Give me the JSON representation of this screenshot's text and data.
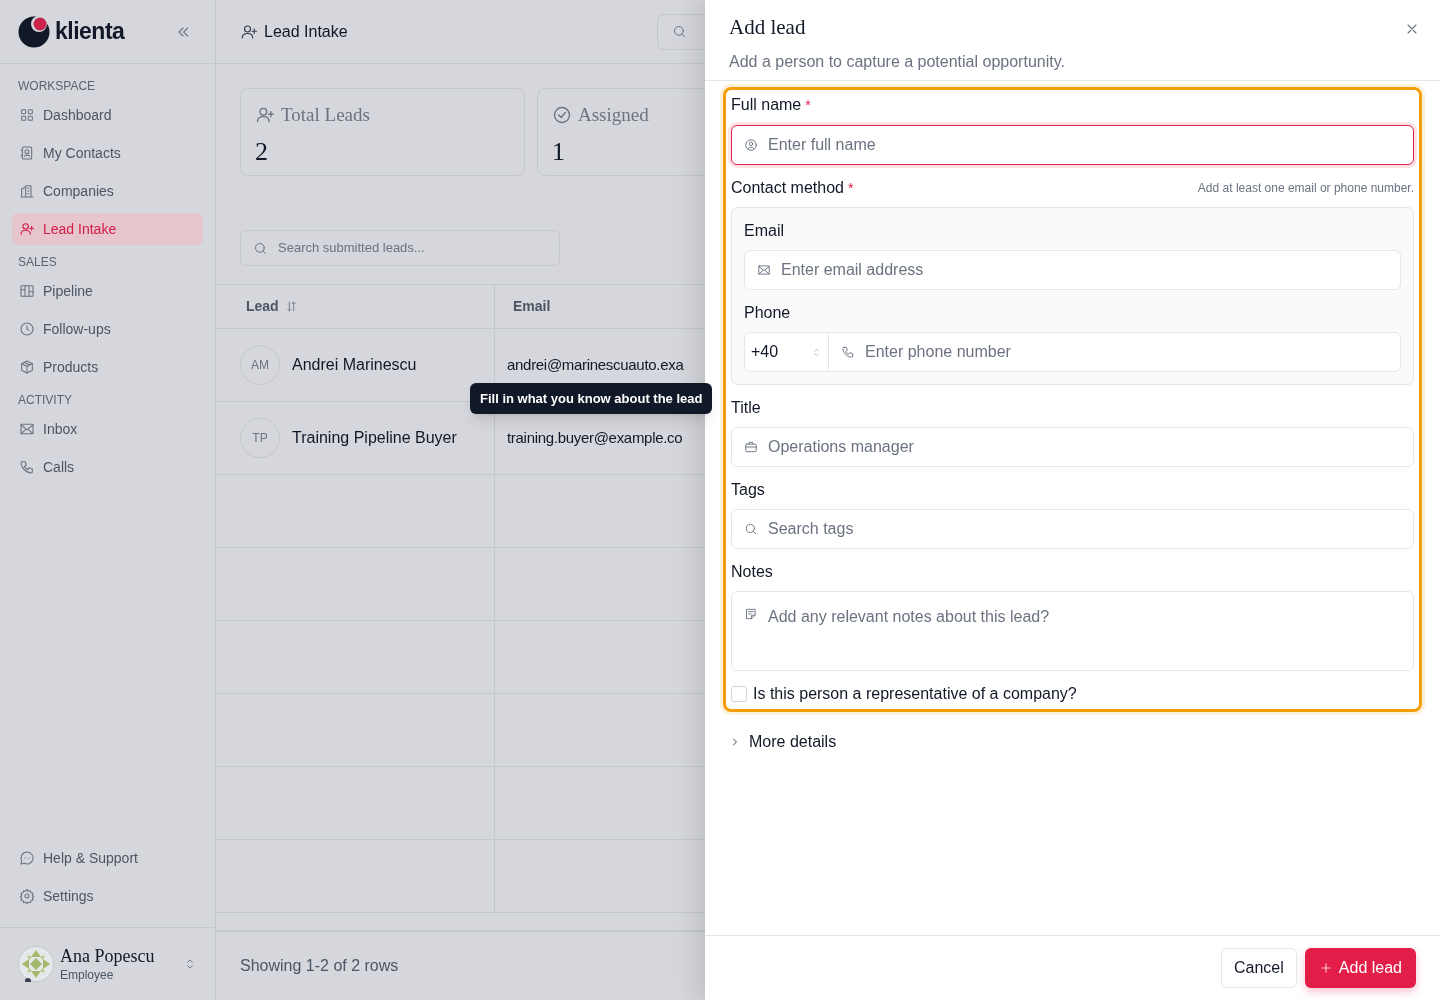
{
  "sidebar": {
    "brand": "klienta",
    "sections": [
      {
        "heading": "WORKSPACE",
        "items": [
          {
            "label": "Dashboard",
            "selected": false
          },
          {
            "label": "My Contacts",
            "selected": false
          },
          {
            "label": "Companies",
            "selected": false
          },
          {
            "label": "Lead Intake",
            "selected": true
          }
        ]
      },
      {
        "heading": "SALES",
        "items": [
          {
            "label": "Pipeline",
            "selected": false
          },
          {
            "label": "Follow-ups",
            "selected": false
          },
          {
            "label": "Products",
            "selected": false
          }
        ]
      },
      {
        "heading": "ACTIVITY",
        "items": [
          {
            "label": "Inbox",
            "selected": false
          },
          {
            "label": "Calls",
            "selected": false
          }
        ]
      }
    ],
    "footer_items": [
      {
        "label": "Help & Support"
      },
      {
        "label": "Settings"
      }
    ],
    "user": {
      "name": "Ana Popescu",
      "role": "Employee"
    }
  },
  "main": {
    "title": "Lead Intake",
    "stats": [
      {
        "label": "Total Leads",
        "value": "2"
      },
      {
        "label": "Assigned",
        "value": "1"
      }
    ],
    "search": {
      "placeholder": "Search submitted leads..."
    },
    "table": {
      "columns": [
        "Lead",
        "Email"
      ],
      "rows": [
        {
          "initials": "AM",
          "name": "Andrei Marinescu",
          "email": "andrei@marinescuauto.exa"
        },
        {
          "initials": "TP",
          "name": "Training Pipeline Buyer",
          "email": "training.buyer@example.co"
        }
      ]
    },
    "footer": "Showing 1-2 of 2 rows"
  },
  "tooltip": "Fill in what you know about the lead",
  "drawer": {
    "title": "Add lead",
    "subtitle": "Add a person to capture a potential opportunity.",
    "form_highlighted": true,
    "full_name": {
      "label": "Full name",
      "required_mark": "*",
      "placeholder": "Enter full name",
      "invalid": true
    },
    "contact_method": {
      "label": "Contact method",
      "required_mark": "*",
      "hint": "Add at least one email or phone number.",
      "email": {
        "label": "Email",
        "placeholder": "Enter email address"
      },
      "phone": {
        "label": "Phone",
        "country_code": "+40",
        "placeholder": "Enter phone number"
      }
    },
    "job_title": {
      "label": "Title",
      "placeholder": "Operations manager"
    },
    "tags": {
      "label": "Tags",
      "placeholder": "Search tags"
    },
    "notes": {
      "label": "Notes",
      "placeholder": "Add any relevant notes about this lead?"
    },
    "representative": {
      "label": "Is this person a representative of a company?",
      "checked": false
    },
    "more_details": {
      "label": "More details",
      "expanded": false
    },
    "buttons": {
      "cancel": "Cancel",
      "submit": "Add lead"
    }
  }
}
